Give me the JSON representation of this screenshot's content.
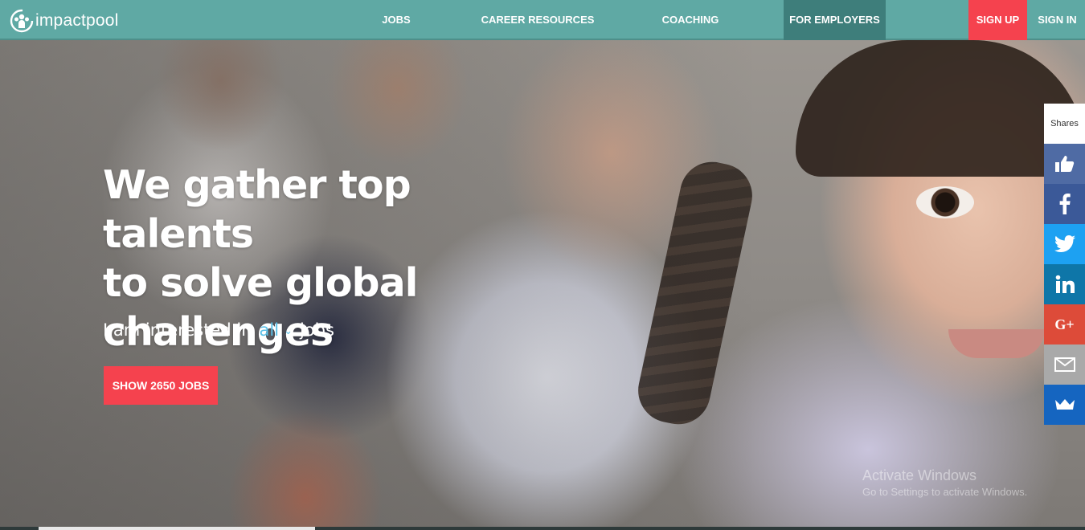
{
  "brand": {
    "name": "impactpool",
    "logo_icon": "people-circle-icon"
  },
  "nav": {
    "jobs": "JOBS",
    "career_resources": "CAREER RESOURCES",
    "coaching": "COACHING",
    "for_employers": "FOR EMPLOYERS",
    "sign_up": "SIGN UP",
    "sign_in": "SIGN IN"
  },
  "hero": {
    "headline_line1": "We gather top talents",
    "headline_line2": "to solve global",
    "headline_line3": "challenges",
    "interest_prefix": "I am interested in",
    "interest_value": "all",
    "interest_suffix": "jobs",
    "cta": "SHOW 2650 JOBS"
  },
  "share": {
    "label": "Shares",
    "buttons": [
      {
        "icon": "thumbs-up-icon",
        "color": "#4f6ba4"
      },
      {
        "icon": "facebook-icon",
        "color": "#3b5998"
      },
      {
        "icon": "twitter-icon",
        "color": "#1da1f2"
      },
      {
        "icon": "linkedin-icon",
        "color": "#0e76a8"
      },
      {
        "icon": "google-plus-icon",
        "color": "#dd4b39"
      },
      {
        "icon": "email-icon",
        "color": "#a9a9a9"
      },
      {
        "icon": "crown-icon",
        "color": "#1565c0"
      }
    ],
    "gplus_text": "G+"
  },
  "watermark": {
    "line1": "Activate Windows",
    "line2": "Go to Settings to activate Windows."
  },
  "colors": {
    "nav_bg": "#5fa9a4",
    "nav_active_bg": "#3e7e7b",
    "accent_red": "#f5424e",
    "link_blue": "#5bc0e8"
  }
}
